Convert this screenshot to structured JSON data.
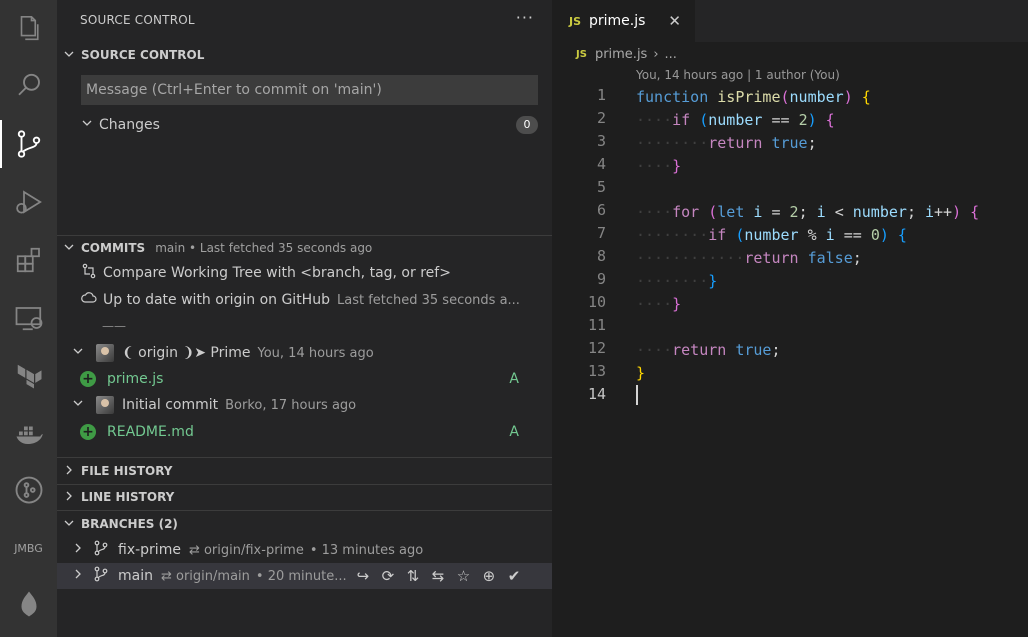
{
  "activity_bar": {
    "items": [
      {
        "name": "explorer-icon"
      },
      {
        "name": "search-icon"
      },
      {
        "name": "source-control-icon",
        "active": true
      },
      {
        "name": "run-debug-icon"
      },
      {
        "name": "extensions-icon"
      },
      {
        "name": "remote-explorer-icon"
      },
      {
        "name": "terraform-icon"
      },
      {
        "name": "docker-icon"
      },
      {
        "name": "gitlens-icon"
      },
      {
        "name": "jmbg-label",
        "text": "JMBG"
      },
      {
        "name": "mongodb-icon"
      }
    ]
  },
  "sidebar": {
    "title": "SOURCE CONTROL",
    "more": "···",
    "scm_section": {
      "header": "SOURCE CONTROL",
      "message_placeholder": "Message (Ctrl+Enter to commit on 'main')",
      "changes_label": "Changes",
      "changes_count": "0"
    },
    "commits": {
      "header": "COMMITS",
      "subtitle": "main • Last fetched 35 seconds ago",
      "compare_label": "Compare Working Tree with <branch, tag, or ref>",
      "uptodate_label": "Up to date with origin on GitHub",
      "uptodate_meta": "Last fetched 35 seconds a...",
      "separator": "——",
      "entries": [
        {
          "message": "❨ origin ❩➤ Prime",
          "meta": "You, 14 hours ago",
          "file": "prime.js",
          "status": "A"
        },
        {
          "message": "Initial commit",
          "meta": "Borko, 17 hours ago",
          "file": "README.md",
          "status": "A"
        }
      ]
    },
    "file_history": {
      "header": "FILE HISTORY"
    },
    "line_history": {
      "header": "LINE HISTORY"
    },
    "branches": {
      "header": "BRANCHES (2)",
      "items": [
        {
          "name": "fix-prime",
          "tracking": "⇄ origin/fix-prime",
          "meta": "•  13 minutes ago"
        },
        {
          "name": "main",
          "tracking": "⇄ origin/main",
          "meta": "•  20 minute..."
        }
      ],
      "row_actions": [
        "↪",
        "⟳",
        "⇅",
        "⇆",
        "☆",
        "⊕",
        "✔"
      ]
    }
  },
  "editor": {
    "tab": {
      "badge": "JS",
      "label": "prime.js",
      "close": "✕"
    },
    "breadcrumb": {
      "badge": "JS",
      "file": "prime.js",
      "sep": "›",
      "rest": "..."
    },
    "codelens": "You, 14 hours ago | 1 author (You)",
    "line_numbers": [
      "1",
      "2",
      "3",
      "4",
      "5",
      "6",
      "7",
      "8",
      "9",
      "10",
      "11",
      "12",
      "13",
      "14"
    ],
    "current_line": 14,
    "code": {
      "l1": {
        "kw": "function",
        "fn": "isPrime",
        "open": "(",
        "param": "number",
        "close": ")",
        "brace": "{"
      },
      "l2": {
        "kw": "if",
        "open": "(",
        "var": "number",
        "op": "==",
        "num": "2",
        "close": ")",
        "brace": "{"
      },
      "l3": {
        "kw": "return",
        "val": "true",
        "semi": ";"
      },
      "l4": {
        "brace": "}"
      },
      "l6": {
        "kw": "for",
        "open": "(",
        "let": "let",
        "i": "i",
        "eq": "=",
        "num": "2",
        "semi1": ";",
        "i2": "i",
        "lt": "<",
        "var": "number",
        "semi2": ";",
        "i3": "i",
        "inc": "++",
        "close": ")",
        "brace": "{"
      },
      "l7": {
        "kw": "if",
        "open": "(",
        "var": "number",
        "mod": "%",
        "i": "i",
        "op": "==",
        "num": "0",
        "close": ")",
        "brace": "{"
      },
      "l8": {
        "kw": "return",
        "val": "false",
        "semi": ";"
      },
      "l9": {
        "brace": "}"
      },
      "l10": {
        "brace": "}"
      },
      "l12": {
        "kw": "return",
        "val": "true",
        "semi": ";"
      },
      "l13": {
        "brace": "}"
      }
    }
  }
}
